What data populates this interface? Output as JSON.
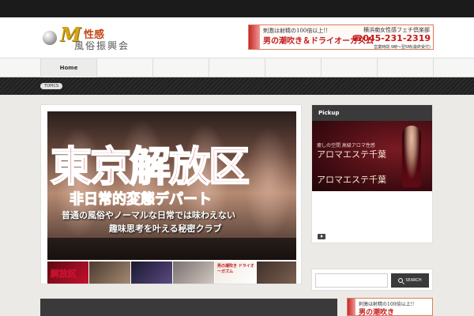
{
  "topbar": {
    "text": ""
  },
  "header": {
    "logo": {
      "mark": "M",
      "top": "性感",
      "bottom": "風俗振興会"
    },
    "banner": {
      "line1": "刺激は射精の100倍以上!!",
      "line2": "男の潮吹き＆ドライオーガズム",
      "line3": "",
      "right1": "横浜痴女性感フェチ倶楽部",
      "right2": "☎045-231-2319",
      "right3": "営業時間 9時〜翌5時(最終受付)"
    }
  },
  "nav": {
    "items": [
      "Home",
      "",
      "",
      "",
      "",
      "",
      "",
      ""
    ],
    "active_index": 0
  },
  "topics": {
    "badge": "TOPICS",
    "text": "",
    "text2": ""
  },
  "hero": {
    "line1": "東京解放区",
    "line2": "非日常的変態デパート",
    "line3": "普通の風俗やノーマルな日常では味わえない",
    "line4": "趣味思考を叶える秘密クラブ",
    "caption": ""
  },
  "thumbnails": [
    {
      "label": "解放区"
    },
    {
      "label": ""
    },
    {
      "label": ""
    },
    {
      "label": ""
    },
    {
      "label": "男の潮吹き ドライオーガズム"
    },
    {
      "label": ""
    }
  ],
  "pickup": {
    "heading": "Pickup",
    "image": {
      "t1": "",
      "t2": "癒しの空間 高級アロマ性感",
      "t3": "アロマエステ千葉",
      "t4": "",
      "t5": "アロマエステ千葉",
      "t6": ""
    },
    "tags": "",
    "title": "",
    "desc": "",
    "more": ""
  },
  "search": {
    "value": "",
    "button": "SEARCH"
  },
  "section": {
    "heading": ""
  },
  "bottom_banner": {
    "line1": "刺激は射精の100倍以上!!",
    "line2": "男の潮吹き"
  }
}
